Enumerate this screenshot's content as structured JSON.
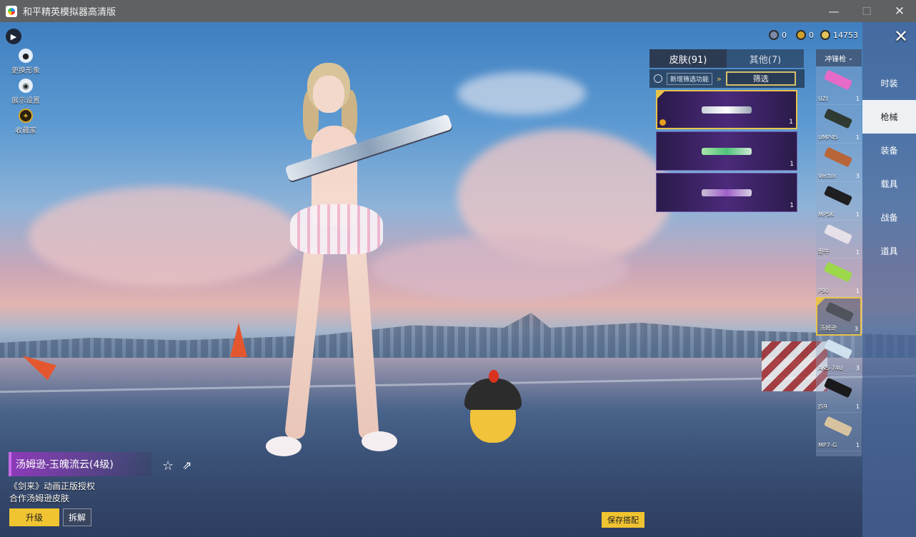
{
  "window": {
    "title": "和平精英模拟器高清版",
    "minimize_glyph": "—",
    "maximize_glyph": "☐",
    "close_glyph": "✕"
  },
  "left_actions": {
    "expand_glyph": "▶",
    "items": [
      {
        "label": "更换形象",
        "icon": "avatar-icon"
      },
      {
        "label": "展示设置",
        "icon": "eye-icon"
      },
      {
        "label": "收藏家",
        "icon": "collector-icon"
      }
    ]
  },
  "currency": [
    {
      "value": "0",
      "icon": "silver-coin-icon"
    },
    {
      "value": "0",
      "icon": "gold-coin-icon"
    },
    {
      "value": "14753",
      "icon": "bean-coin-icon"
    }
  ],
  "close_glyph": "✕",
  "skin_panel": {
    "tabs": [
      {
        "label": "皮肤(91)",
        "active": true
      },
      {
        "label": "其他(7)",
        "active": false
      }
    ],
    "new_filter_label": "新增筛选功能",
    "filter_label": "筛选",
    "skins": [
      {
        "count": "1",
        "selected": true
      },
      {
        "count": "1",
        "selected": false
      },
      {
        "count": "1",
        "selected": false
      }
    ]
  },
  "weapon_type": "冲锋枪",
  "weapons": [
    {
      "name": "UZI",
      "count": "1"
    },
    {
      "name": "UMP45",
      "count": "1"
    },
    {
      "name": "Vector",
      "count": "3"
    },
    {
      "name": "MP5K",
      "count": "1"
    },
    {
      "name": "野牛",
      "count": "1"
    },
    {
      "name": "P90",
      "count": "1"
    },
    {
      "name": "汤姆逊",
      "count": "3",
      "selected": true
    },
    {
      "name": "AKS-74U",
      "count": "3"
    },
    {
      "name": "JS9",
      "count": "1"
    },
    {
      "name": "MP7-G",
      "count": "1"
    }
  ],
  "categories": [
    {
      "label": "时装",
      "active": false
    },
    {
      "label": "枪械",
      "active": true
    },
    {
      "label": "装备",
      "active": false
    },
    {
      "label": "载具",
      "active": false
    },
    {
      "label": "战备",
      "active": false
    },
    {
      "label": "道具",
      "active": false
    }
  ],
  "item": {
    "name": "汤姆逊-玉魄流云(4级)",
    "desc_line1": "《剑来》动画正版授权",
    "desc_line2": "合作汤姆逊皮肤",
    "favorite_glyph": "☆",
    "share_glyph": "⇗"
  },
  "buttons": {
    "upgrade": "升级",
    "dismantle": "拆解",
    "save_outfit": "保存搭配"
  },
  "colors": {
    "accent_gold": "#f0c330",
    "selection_border": "#e8c24a",
    "nav_active_bg": "#eef0f4"
  }
}
